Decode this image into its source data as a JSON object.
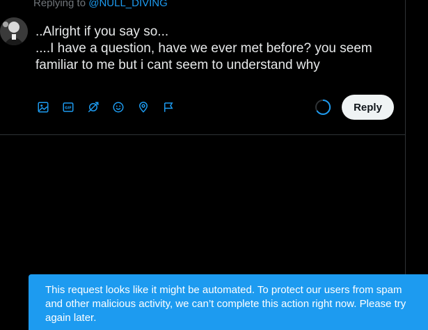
{
  "reply_context": {
    "prefix": "Replying to",
    "handle": "@NULL_DIVING"
  },
  "tweet": {
    "line1": "..Alright if you say so...",
    "line2": "....I have a question, have we ever met before? you seem familiar to me but i cant seem to understand why"
  },
  "toolbar": {
    "icons": [
      "image-icon",
      "gif-icon",
      "poll-icon",
      "emoji-icon",
      "location-icon",
      "flag-icon"
    ]
  },
  "reply_button": {
    "label": "Reply"
  },
  "colors": {
    "accent": "#1d9bf0",
    "background": "#000000",
    "text": "#e7e9ea",
    "button_bg": "#eff3f4",
    "divider": "#2f3336"
  },
  "toast": {
    "message": "This request looks like it might be automated. To protect our users from spam and other malicious activity, we can’t complete this action right now. Please try again later."
  }
}
